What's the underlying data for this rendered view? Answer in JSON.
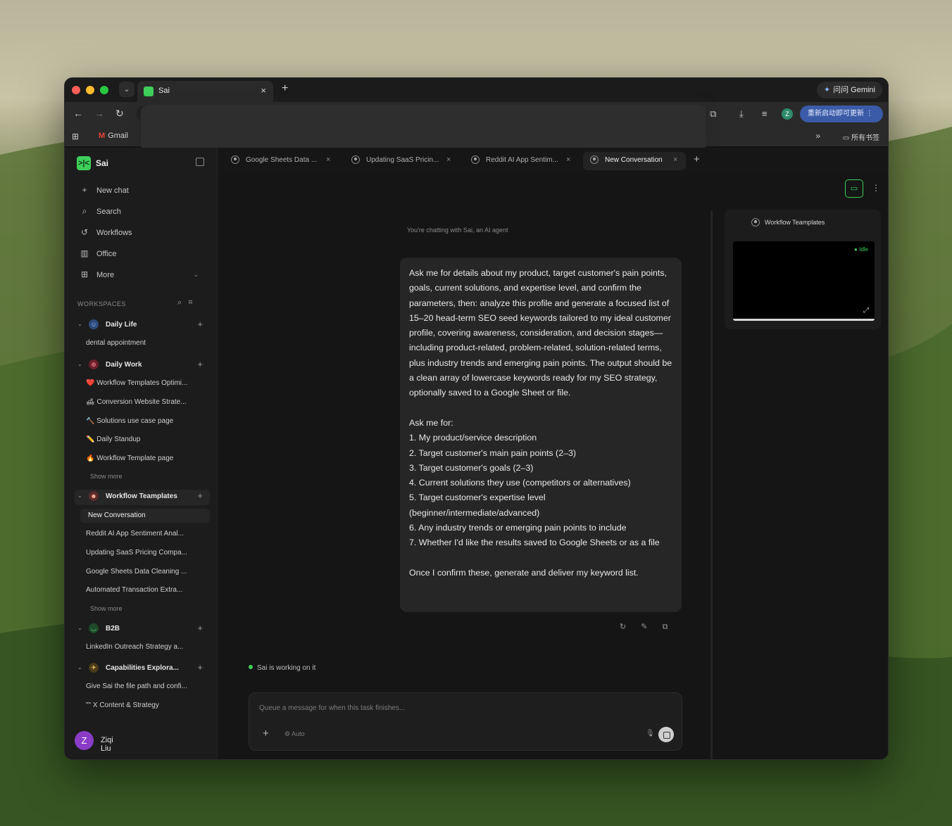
{
  "browser": {
    "tab_title": "Sai",
    "gemini_label": "问问 Gemini",
    "restart_label": "重新启动即可更新",
    "profile_initial": "Z",
    "bookmarks": {
      "gmail": "Gmail",
      "all_bookmarks": "所有书签"
    }
  },
  "sidebar": {
    "brand": "Sai",
    "nav": [
      {
        "label": "New chat",
        "icon": "plus-icon"
      },
      {
        "label": "Search",
        "icon": "search-icon"
      },
      {
        "label": "Workflows",
        "icon": "history-icon"
      },
      {
        "label": "Office",
        "icon": "office-icon"
      },
      {
        "label": "More",
        "icon": "grid-icon"
      }
    ],
    "workspaces_header": "WORKSPACES",
    "groups": {
      "daily_life": {
        "label": "Daily Life",
        "items": [
          "dental appointment"
        ]
      },
      "daily_work": {
        "label": "Daily Work",
        "items": [
          "❤️ Workflow Templates Optimi...",
          "🛋 Conversion Website Strate...",
          "🔨 Solutions use case page",
          "✏️ Daily Standup",
          "🔥 Workflow Template page"
        ],
        "show_more": "Show more"
      },
      "workflow_templates": {
        "label": "Workflow Teamplates",
        "items": [
          "New Conversation",
          "Reddit AI App Sentiment Anal...",
          "Updating SaaS Pricing Compa...",
          "Google Sheets Data Cleaning ...",
          "Automated Transaction Extra..."
        ],
        "show_more": "Show more"
      },
      "b2b": {
        "label": "B2B",
        "items": [
          "LinkedIn Outreach Strategy a..."
        ]
      },
      "capabilities": {
        "label": "Capabilities Explora...",
        "items": [
          "Give Sai the file path and confi...",
          "\"\" X Content & Strategy"
        ]
      }
    },
    "user": {
      "initial": "Z",
      "name": "Ziqi Liu"
    }
  },
  "tabs": [
    {
      "label": "Google Sheets Data ..."
    },
    {
      "label": "Updating SaaS Pricin..."
    },
    {
      "label": "Reddit AI App Sentim..."
    },
    {
      "label": "New Conversation"
    }
  ],
  "chat": {
    "note": "You're chatting with Sai, an AI agent",
    "message": "Ask me for details about my product, target customer's pain points, goals, current solutions, and expertise level, and confirm the parameters, then: analyze this profile and generate a focused list of 15–20 head-term SEO seed keywords tailored to my ideal customer profile, covering awareness, consideration, and decision stages—including product-related, problem-related, solution-related terms, plus industry trends and emerging pain points. The output should be a clean array of lowercase keywords ready for my SEO strategy, optionally saved to a Google Sheet or file.\n\nAsk me for:\n1. My product/service description\n2. Target customer's main pain points (2–3)\n3. Target customer's goals (2–3)\n4. Current solutions they use (competitors or alternatives)\n5. Target customer's expertise level (beginner/intermediate/advanced)\n6. Any industry trends or emerging pain points to include\n7. Whether I'd like the results saved to Google Sheets or as a file\n\nOnce I confirm these, generate and deliver my keyword list.",
    "status": "Sai is working on it",
    "composer_placeholder": "Queue a message for when this task finishes...",
    "composer_mode": "Auto"
  },
  "panel": {
    "preview_title": "Workflow Teamplates",
    "status": "Idle"
  }
}
